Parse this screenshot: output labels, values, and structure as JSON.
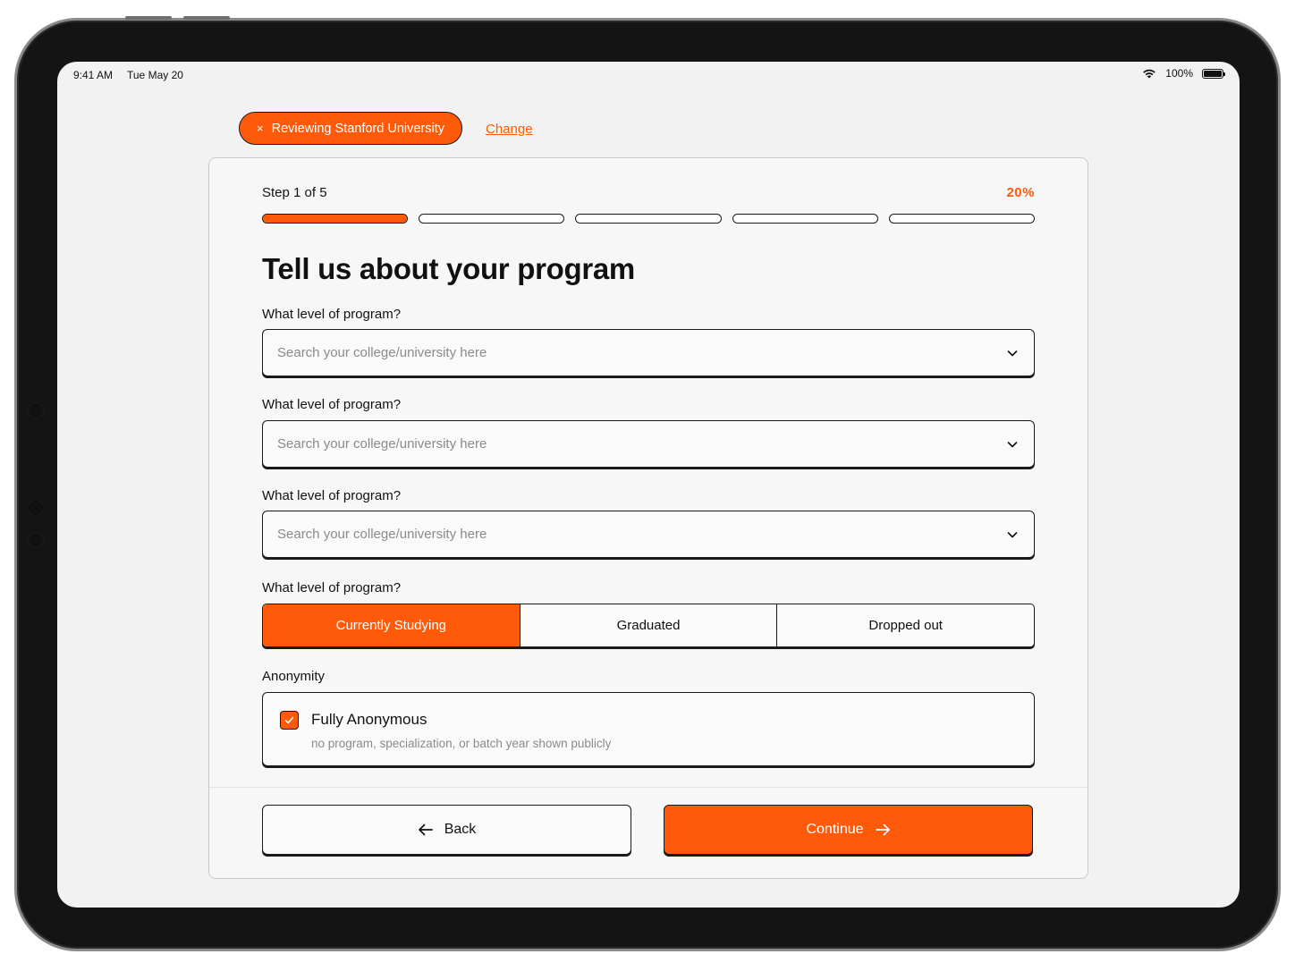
{
  "status_bar": {
    "time": "9:41 AM",
    "date": "Tue May 20",
    "battery": "100%"
  },
  "header": {
    "reviewing_label": "Reviewing Stanford University",
    "close_glyph": "×",
    "change_link": "Change"
  },
  "progress": {
    "step_label": "Step 1 of 5",
    "percent_label": "20%",
    "total_steps": 5,
    "current_step": 1,
    "fraction": 0.2
  },
  "form": {
    "title": "Tell us about your program",
    "fields": [
      {
        "label": "What level of program?",
        "placeholder": "Search your college/university here"
      },
      {
        "label": "What level of program?",
        "placeholder": "Search your college/university here"
      },
      {
        "label": "What level of program?",
        "placeholder": "Search your college/university here"
      }
    ],
    "status_field": {
      "label": "What level of program?",
      "options": [
        "Currently Studying",
        "Graduated",
        "Dropped out"
      ],
      "selected": "Currently Studying"
    },
    "anonymity": {
      "label": "Anonymity",
      "option_title": "Fully Anonymous",
      "option_description": "no program, specialization, or batch year shown publicly",
      "checked": true
    }
  },
  "footer": {
    "back_label": "Back",
    "continue_label": "Continue"
  },
  "colors": {
    "accent": "#ff5a0a",
    "border": "#1a1a1a",
    "background": "#f2f2f2"
  },
  "icons": [
    "wifi-icon",
    "battery-icon",
    "close-icon",
    "chevron-down-icon",
    "check-icon",
    "arrow-left-icon",
    "arrow-right-icon"
  ]
}
